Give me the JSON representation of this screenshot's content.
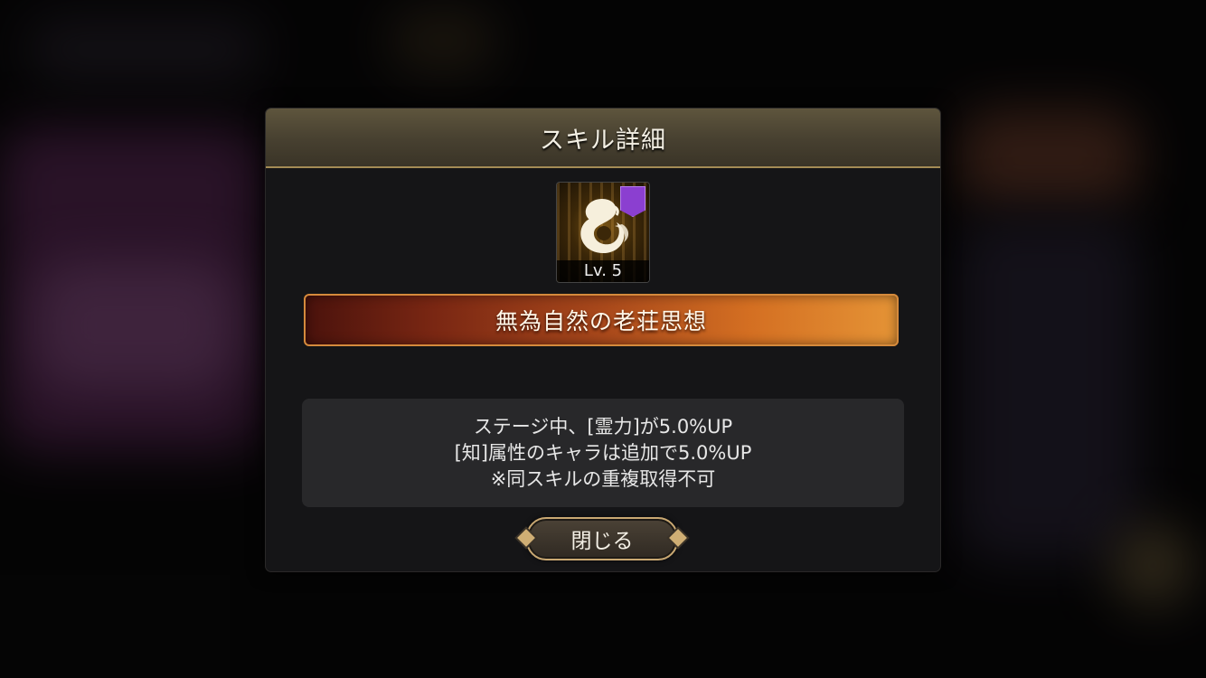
{
  "dialog": {
    "title": "スキル詳細",
    "skill": {
      "level_label": "Lv. 5",
      "name": "無為自然の老荘思想",
      "icon": "swan-flame-icon",
      "rarity_color": "#8b3fd0"
    },
    "description": [
      "ステージ中、[霊力]が5.0%UP",
      "[知]属性のキャラは追加で5.0%UP",
      "※同スキルの重複取得不可"
    ],
    "close_label": "閉じる"
  },
  "colors": {
    "header": "#4a4332",
    "banner_from": "#4a120c",
    "banner_to": "#e59436",
    "desc_bg": "#28282a"
  }
}
